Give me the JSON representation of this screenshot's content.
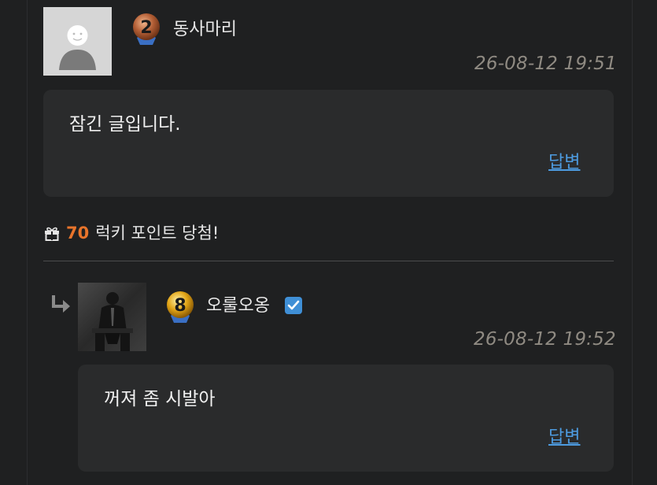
{
  "comments": [
    {
      "level": "2",
      "nickname": "동사마리",
      "timestamp": "26-08-12 19:51",
      "content": "잠긴 글입니다.",
      "reply_label": "답변"
    },
    {
      "level": "8",
      "nickname": "오룰오옹",
      "timestamp": "26-08-12 19:52",
      "content": "꺼져 좀 시발아",
      "reply_label": "답변"
    }
  ],
  "lucky": {
    "points": "70",
    "text": "럭키 포인트 당첨!"
  },
  "colors": {
    "background": "#1f2021",
    "box": "#2a2b2c",
    "accent_orange": "#e8742b",
    "link_blue": "#4d9be0",
    "timestamp_gray": "#8f8a82"
  }
}
